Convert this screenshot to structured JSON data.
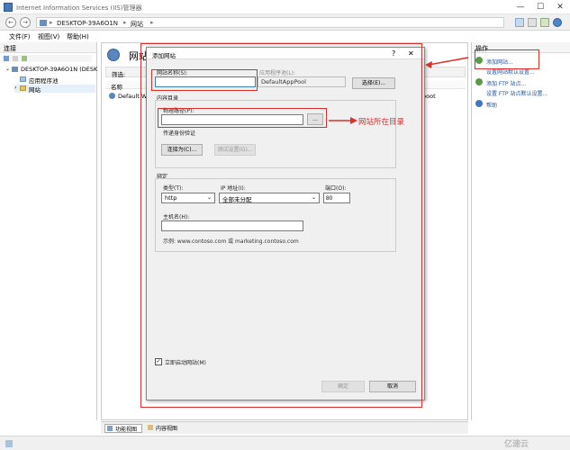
{
  "window": {
    "title": "Internet Information Services (IIS)管理器",
    "controls": {
      "minimize": "—",
      "maximize": "☐",
      "close": "✕"
    }
  },
  "addressbar": {
    "back": "←",
    "forward": "→",
    "crumbs": [
      "DESKTOP-39A6O1N",
      "网站"
    ]
  },
  "menu": {
    "file": "文件(F)",
    "view": "视图(V)",
    "help": "帮助(H)"
  },
  "connections": {
    "header": "连接",
    "tree": [
      {
        "label": "DESKTOP-39A6O1N (DESK"
      },
      {
        "label": "应用程序池"
      },
      {
        "label": "网站"
      }
    ]
  },
  "center": {
    "title": "网站",
    "filter_label": "筛选:",
    "column_name": "名称",
    "row_default": "Default We",
    "row_right_fragment": "boot"
  },
  "actions": {
    "header": "操作",
    "items": [
      {
        "label": "添加网站..."
      },
      {
        "label": "设置网站默认设置..."
      },
      {
        "label": "添加 FTP 站点..."
      },
      {
        "label": "设置 FTP 站点默认设置..."
      },
      {
        "label": "帮助"
      }
    ]
  },
  "views": {
    "features": "功能视图",
    "content": "内容视图"
  },
  "dialog": {
    "title": "添加网站",
    "site_name_label": "网站名称(S):",
    "site_name_value": "",
    "app_pool_label": "应用程序池(L):",
    "app_pool_value": "DefaultAppPool",
    "select_button": "选择(E)...",
    "content_dir_label": "内容目录",
    "physical_path_label": "物理路径(P):",
    "physical_path_value": "",
    "browse_button": "...",
    "passthrough_label": "传递身份验证",
    "connect_as_button": "连接为(C)...",
    "test_settings_button": "测试设置(G)...",
    "binding_label": "绑定",
    "type_label": "类型(T):",
    "type_value": "http",
    "ip_label": "IP 地址(I):",
    "ip_value": "全部未分配",
    "port_label": "端口(O):",
    "port_value": "80",
    "hostname_label": "主机名(H):",
    "hostname_value": "",
    "example_text": "示例: www.contoso.com 或 marketing.contoso.com",
    "start_checkbox_label": "立即启动网站(M)",
    "start_checked": true,
    "ok_button": "确定",
    "cancel_button": "取消",
    "help_glyph": "?",
    "close_glyph": "✕"
  },
  "annotation": {
    "text": "网站所在目录",
    "color": "#d9302c"
  },
  "watermark": {
    "text": "亿速云"
  }
}
